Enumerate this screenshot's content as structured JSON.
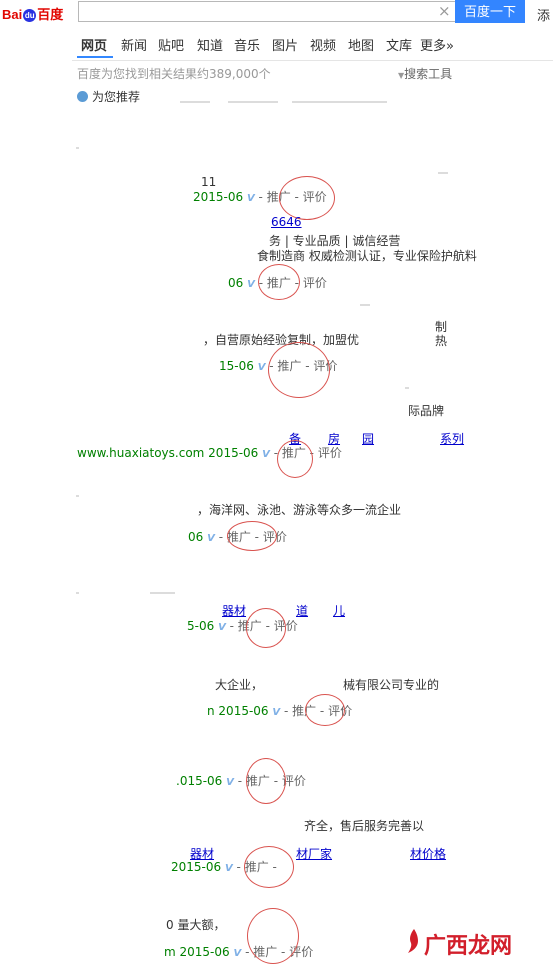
{
  "logo": {
    "text_left": "Bai",
    "text_paw": "du",
    "text_right": "百度"
  },
  "search": {
    "value": "",
    "button_label": "百度一下",
    "extra_link": "添"
  },
  "tabs": [
    "网页",
    "新闻",
    "贴吧",
    "知道",
    "音乐",
    "图片",
    "视频",
    "地图",
    "文库",
    "更多»"
  ],
  "result_count": "百度为您找到相关结果约389,000个",
  "search_tools": "搜索工具",
  "recommend": "为您推荐",
  "promo_label": "- 推广 -",
  "review_label": "评价",
  "v_mark": "V",
  "results": [
    {
      "date": "2015-06",
      "frag": "11"
    },
    {
      "date": "06",
      "link": "6646",
      "frag1": "务 | 专业品质 | 诚信经营",
      "frag2": "食制造商 权威检测认证，专业保险护航料"
    },
    {
      "date": "15-06",
      "frag1": "制",
      "frag2": "，自营原始经验复制，加盟优",
      "frag3": "热"
    },
    {
      "date": "www.huaxiatoys.com  2015-06",
      "frag1": "际品牌",
      "links": [
        "备",
        "房",
        "园",
        "系列"
      ]
    },
    {
      "date": "06",
      "frag1": "，海洋网、泳池、游泳等众多一流企业"
    },
    {
      "date": "5-06",
      "links": [
        "器材",
        "道",
        "儿"
      ]
    },
    {
      "date": "n  2015-06",
      "frag1": "大企业，",
      "frag2": "械有限公司专业的"
    },
    {
      "date": ".015-06"
    },
    {
      "date": "2015-06",
      "frag1": "齐全，售后服务完善以",
      "links": [
        "器材",
        "材厂家",
        "材价格"
      ]
    },
    {
      "date": "m  2015-06",
      "frag1": "0 量大额，"
    }
  ],
  "watermark": "广西龙网",
  "colors": {
    "accent": "#3385ff",
    "brand_red": "#e10601",
    "date_green": "#008000",
    "ring_red": "#d9534f"
  }
}
